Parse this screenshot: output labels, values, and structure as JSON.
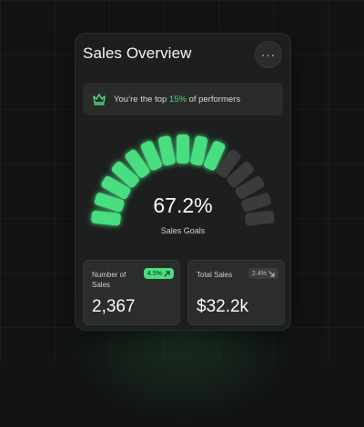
{
  "card": {
    "title": "Sales Overview",
    "more_icon_glyph": "···"
  },
  "banner": {
    "icon": "crown-icon",
    "text_before": "You’re the top ",
    "highlight": "15%",
    "text_after": " of performers"
  },
  "gauge": {
    "value_text": "67.2%",
    "label": "Sales Goals",
    "progress": 0.672,
    "segments": 15,
    "active_color": "#4ade80",
    "inactive_color": "#3a3c3b"
  },
  "stats": [
    {
      "label": "Number of Sales",
      "badge": "4.5%",
      "badge_direction": "up",
      "value": "2,367"
    },
    {
      "label": "Total Sales",
      "badge": "2.4%",
      "badge_direction": "down",
      "value": "$32.2k"
    }
  ],
  "colors": {
    "accent": "#4ade80",
    "background": "#121413",
    "card": "#1d1f1e"
  }
}
